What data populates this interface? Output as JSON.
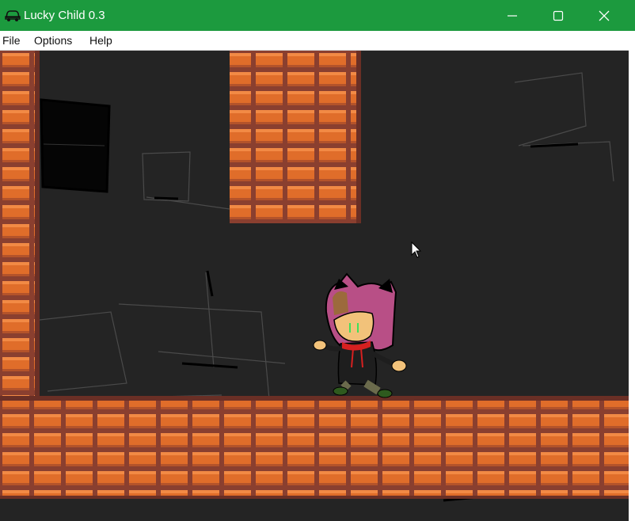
{
  "window": {
    "title": "Lucky Child 0.3",
    "app_icon": "car-icon",
    "controls": [
      "minimize-icon",
      "maximize-icon",
      "close-icon"
    ]
  },
  "menu": {
    "items": [
      {
        "label": "File"
      },
      {
        "label": "Options"
      },
      {
        "label": "Help"
      }
    ]
  },
  "colors": {
    "titlebar": "#1c9a3e",
    "game_background": "#242424",
    "brick": "#e06d2a",
    "brick_highlight": "#f28a45",
    "mortar": "#8a3f2f",
    "hair": "#b84f86",
    "skin": "#f2c27a",
    "jacket": "#1e1e1e",
    "eyes": "#3ee05a"
  },
  "scene": {
    "character": "player-character",
    "cursor": "mouse-pointer-icon"
  }
}
